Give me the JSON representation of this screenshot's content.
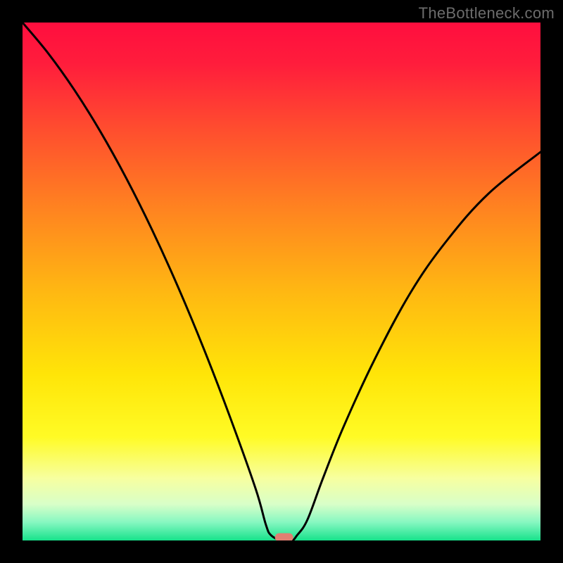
{
  "watermark": "TheBottleneck.com",
  "chart_data": {
    "type": "line",
    "title": "",
    "xlabel": "",
    "ylabel": "",
    "xlim": [
      0,
      100
    ],
    "ylim": [
      0,
      100
    ],
    "series": [
      {
        "name": "bottleneck-curve",
        "x": [
          0,
          5,
          10,
          15,
          20,
          25,
          30,
          35,
          40,
          45,
          47,
          48,
          50,
          52,
          53,
          55,
          58,
          62,
          68,
          75,
          82,
          90,
          100
        ],
        "y": [
          100,
          94,
          87,
          79,
          70,
          60,
          49,
          37,
          24,
          10,
          3,
          1,
          0,
          0,
          1,
          4,
          12,
          22,
          35,
          48,
          58,
          67,
          75
        ]
      }
    ],
    "marker": {
      "x": 50.5,
      "y": 0.6
    },
    "gradient_stops": [
      {
        "offset": 0.0,
        "color": "#ff0e3e"
      },
      {
        "offset": 0.08,
        "color": "#ff1d3c"
      },
      {
        "offset": 0.2,
        "color": "#ff4b2f"
      },
      {
        "offset": 0.35,
        "color": "#ff8021"
      },
      {
        "offset": 0.52,
        "color": "#ffb812"
      },
      {
        "offset": 0.68,
        "color": "#ffe508"
      },
      {
        "offset": 0.8,
        "color": "#fffb25"
      },
      {
        "offset": 0.88,
        "color": "#f7ffa0"
      },
      {
        "offset": 0.93,
        "color": "#d8ffc8"
      },
      {
        "offset": 0.965,
        "color": "#86f7c1"
      },
      {
        "offset": 1.0,
        "color": "#17e28b"
      }
    ]
  }
}
